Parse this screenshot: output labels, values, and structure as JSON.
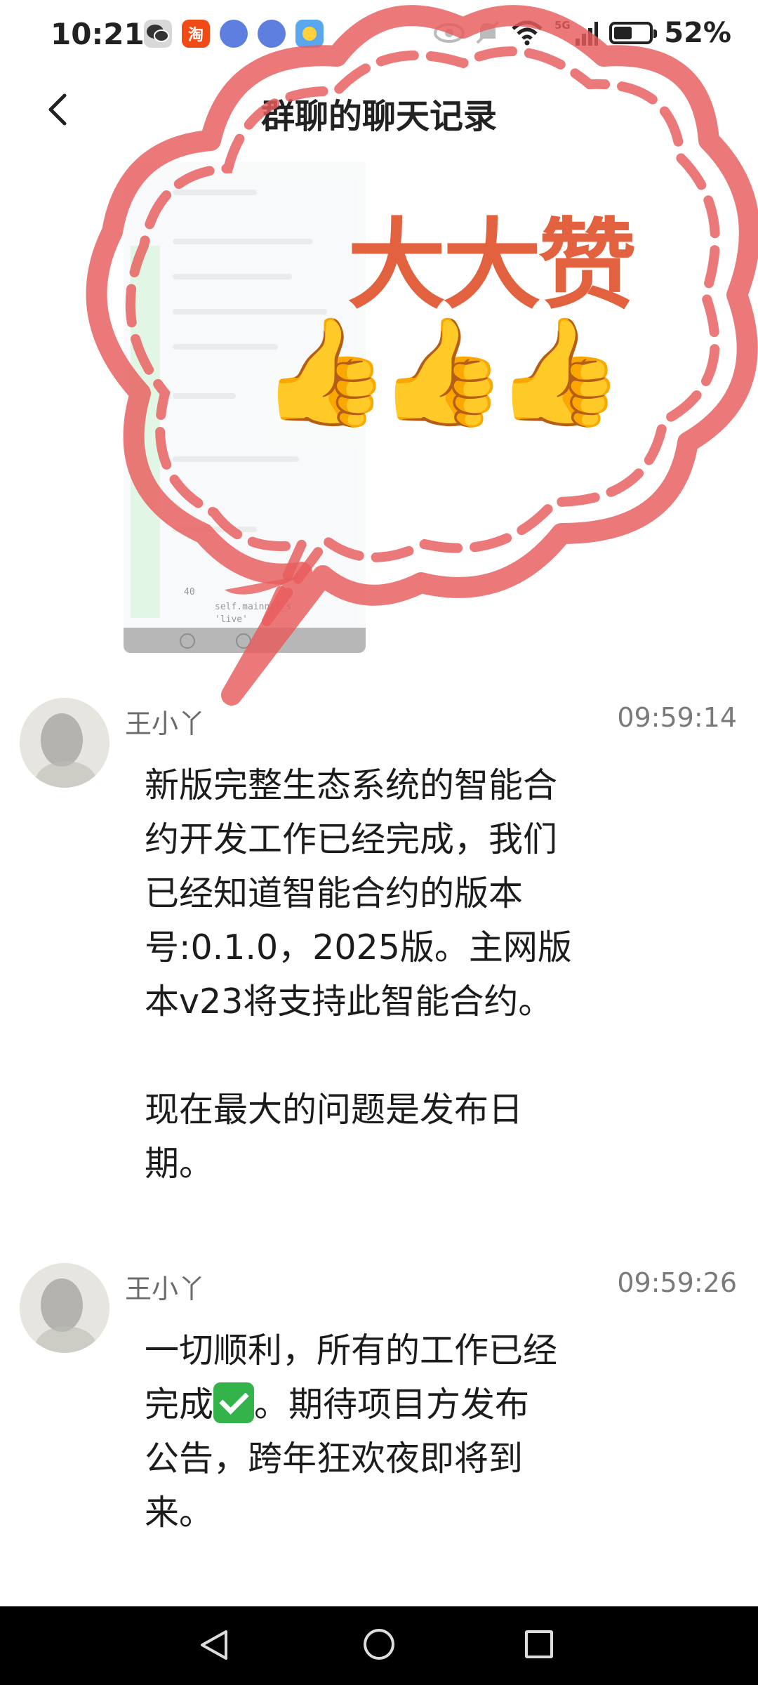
{
  "status_bar": {
    "time": "10:21",
    "app_taobao": "淘",
    "battery_text": "52%",
    "battery_level": 0.52,
    "network": "5G"
  },
  "header": {
    "title": "群聊的聊天记录"
  },
  "sticker": {
    "text": "大大赞",
    "thumbs": "👍👍👍"
  },
  "screenshot_image": {
    "line_number": "40",
    "code_lines": [
      "self.mainnet_s",
      "'live'"
    ]
  },
  "messages": [
    {
      "sender": "王小丫",
      "time": "09:59:14",
      "text": "新版完整生态系统的智能合\n约开发工作已经完成，我们\n已经知道智能合约的版本\n号:0.1.0，2025版。主网版\n本v23将支持此智能合约。\n\n现在最大的问题是发布日\n期。"
    },
    {
      "sender": "王小丫",
      "time": "09:59:26",
      "text_before": "一切顺利，所有的工作已经\n完成",
      "text_after": "。期待项目方发布\n公告，跨年狂欢夜即将到\n来。"
    }
  ],
  "colors": {
    "sticker_red": "#e85c5c",
    "sticker_text": "#e2623f",
    "check_green": "#34b34a"
  }
}
